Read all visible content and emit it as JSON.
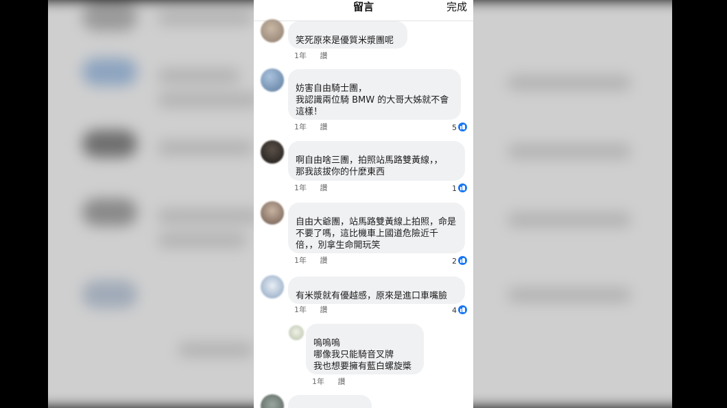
{
  "header": {
    "title": "留言",
    "done_label": "完成"
  },
  "comments": [
    {
      "name": "",
      "text": "笑死原來是優質米漿團呢",
      "time": "1年",
      "reply": "讚",
      "likes": ""
    },
    {
      "name": "",
      "text": "妨害自由騎士團，\n我認識兩位騎 BMW 的大哥大姊就不會這樣！",
      "time": "1年",
      "reply": "讚",
      "likes": "5"
    },
    {
      "name": "",
      "text": "啊自由啥三團，拍照站馬路雙黃線，，\n那我該拔你的什麼東西",
      "time": "1年",
      "reply": "讚",
      "likes": "1"
    },
    {
      "name": "",
      "text": "自由大爺團，站馬路雙黃線上拍照，命是不要了嗎，這比機車上國道危險近千倍，，別拿生命開玩笑",
      "time": "1年",
      "reply": "讚",
      "likes": "2"
    },
    {
      "name": "",
      "text": "有米漿就有優越感，原來是進口車嘴臉",
      "time": "1年",
      "reply": "讚",
      "likes": "4"
    },
    {
      "name": "",
      "text": "嗚嗚嗚\n哪像我只能騎音叉牌\n我也想要擁有藍白螺旋槳",
      "time": "1年",
      "reply": "讚",
      "likes": ""
    }
  ],
  "colors": {
    "like_blue": "#1877f2",
    "bubble_bg": "#f0f1f3"
  }
}
